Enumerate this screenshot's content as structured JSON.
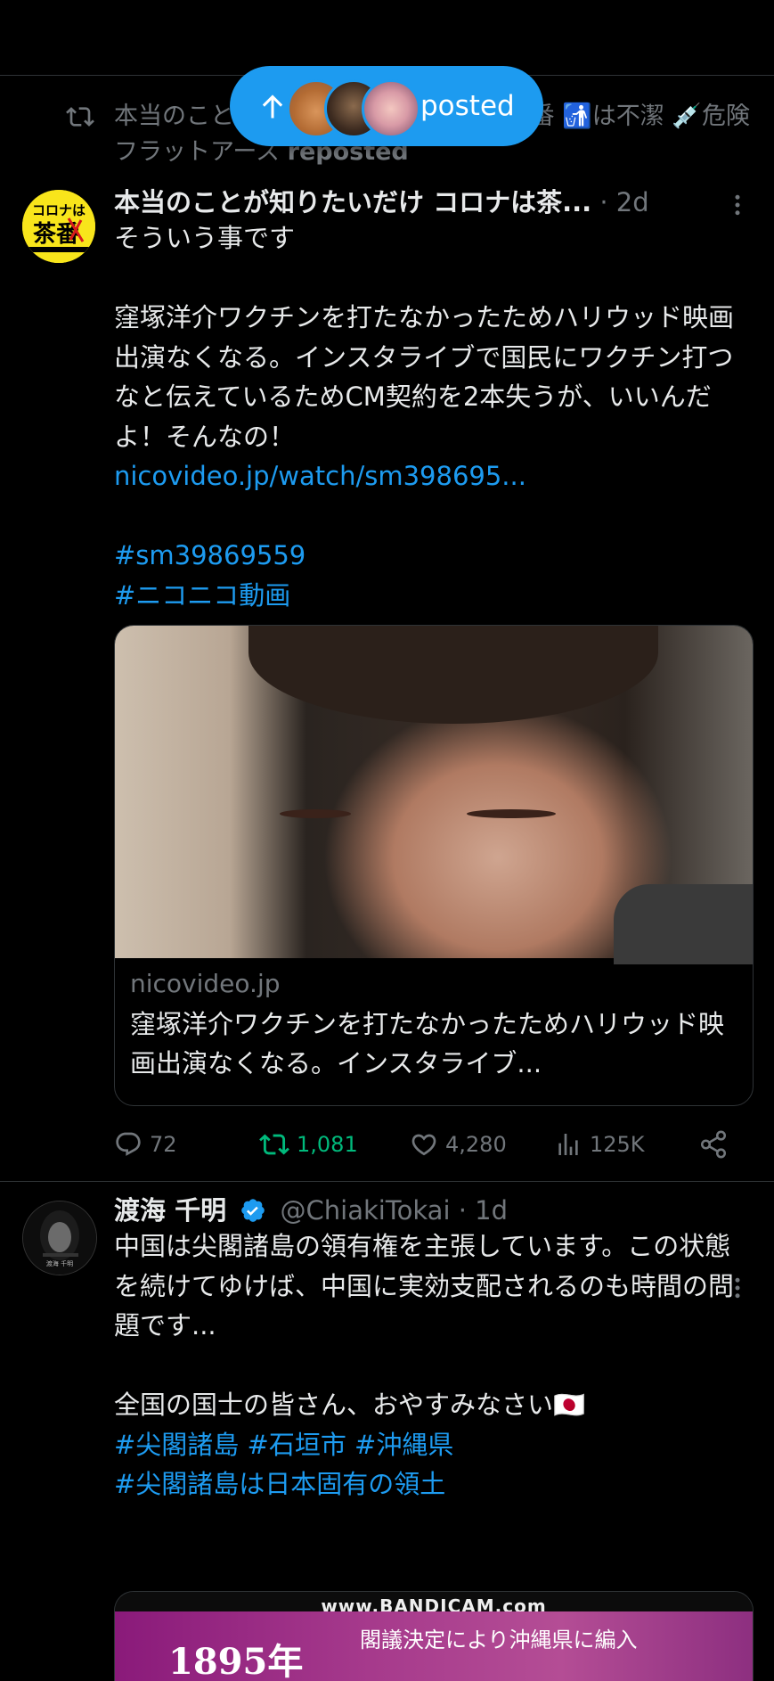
{
  "new_posts_pill": {
    "label": "posted"
  },
  "repost_line": {
    "text": "本当のことが知りたいだけ コロナは茶番 🚮は不潔 💉危険　フラットアース",
    "suffix": "reposted"
  },
  "tweet1": {
    "author_name": "本当のことが知りたいだけ コロナは茶...",
    "time": "· 2d",
    "avatar_text": "コロナは茶番",
    "lines": [
      "そういう事です",
      "",
      "窪塚洋介ワクチンを打たなかったためハリウッド映画出演なくなる。インスタライブで国民にワクチン打つなと伝えているためCM契約を2本失うが、いいんだよ！そんなの！"
    ],
    "link": "nicovideo.jp/watch/sm398695...",
    "hashtag1": "#sm39869559",
    "hashtag2": "#ニコニコ動画",
    "card": {
      "domain": "nicovideo.jp",
      "title": "窪塚洋介ワクチンを打たなかったためハリウッド映画出演なくなる。インスタライブ..."
    },
    "stats": {
      "replies": "72",
      "reposts": "1,081",
      "likes": "4,280",
      "views": "125K"
    }
  },
  "tweet2": {
    "author_name": "渡海 千明",
    "handle": "@ChiakiTokai",
    "time": "· 1d",
    "avatar_text": "渡海 千明",
    "line1": "中国は尖閣諸島の領有権を主張しています。この状態を続けてゆけば、中国に実効支配されるのも時間の問題です...",
    "line2": "全国の国士の皆さん、おやすみなさい🇯🇵",
    "hashtags_a": "#尖閣諸島 #石垣市 #沖縄県",
    "hashtags_b": "#尖閣諸島は日本固有の領土",
    "media": {
      "watermark": "www.BANDICAM.com",
      "big_text": "1895年",
      "small_text": "閣議決定により沖縄県に編入"
    }
  },
  "colors": {
    "accent": "#1d9bf0",
    "repost_green": "#00ba7c",
    "muted": "#71767b",
    "text": "#e7e9ea",
    "background": "#000000"
  }
}
